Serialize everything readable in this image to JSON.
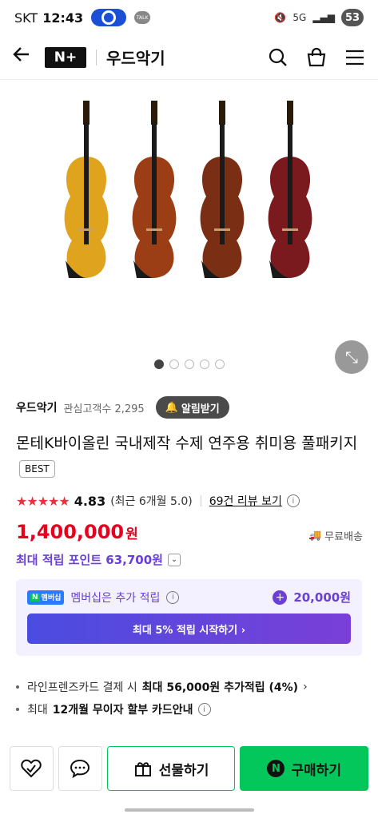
{
  "status_bar": {
    "carrier": "SKT",
    "time": "12:43",
    "talk_label": "TALK",
    "network": "5G",
    "battery": "53"
  },
  "header": {
    "logo": "N+",
    "store_name": "우드악기",
    "icons": [
      "back-arrow-icon",
      "search-icon",
      "bag-icon",
      "menu-icon"
    ]
  },
  "hero": {
    "image_description_icon": "violins-image",
    "carousel_count": 5,
    "carousel_active": 1,
    "violin_colors": [
      "#e0a31d",
      "#9b3e15",
      "#7a2e14",
      "#7a1a1e"
    ]
  },
  "seller": {
    "name": "우드악기",
    "followers_label": "관심고객수 2,295",
    "alarm_label": "알림받기"
  },
  "product": {
    "title": "몬테K바이올린 국내제작 수제 연주용 취미용 풀패키지",
    "badge": "BEST"
  },
  "rating": {
    "stars": "★★★★★",
    "score": "4.83",
    "recent": "(최근 6개월 5.0)",
    "review_link": "69건 리뷰 보기"
  },
  "price": {
    "amount": "1,400,000",
    "currency": "원",
    "shipping": "무료배송"
  },
  "points": {
    "label": "최대 적립 포인트 63,700원"
  },
  "membership": {
    "badge_n": "N",
    "badge_text": "멤버십",
    "text": "멤버십은 추가 적립",
    "bonus": "20,000원",
    "cta": "최대 5% 적립 시작하기 ›"
  },
  "benefits": [
    {
      "pre": "라인프렌즈카드 결제 시 ",
      "bold": "최대 56,000원 추가적립 (4%)",
      "post": " ›"
    },
    {
      "pre": "최대 ",
      "bold": "12개월 무이자 할부 카드안내",
      "post": ""
    }
  ],
  "bottom": {
    "gift_label": "선물하기",
    "buy_label": "구매하기",
    "buy_logo": "N"
  },
  "colors": {
    "naver_green": "#03c75a",
    "price_red": "#e8001f",
    "purple": "#6a3fd6"
  }
}
